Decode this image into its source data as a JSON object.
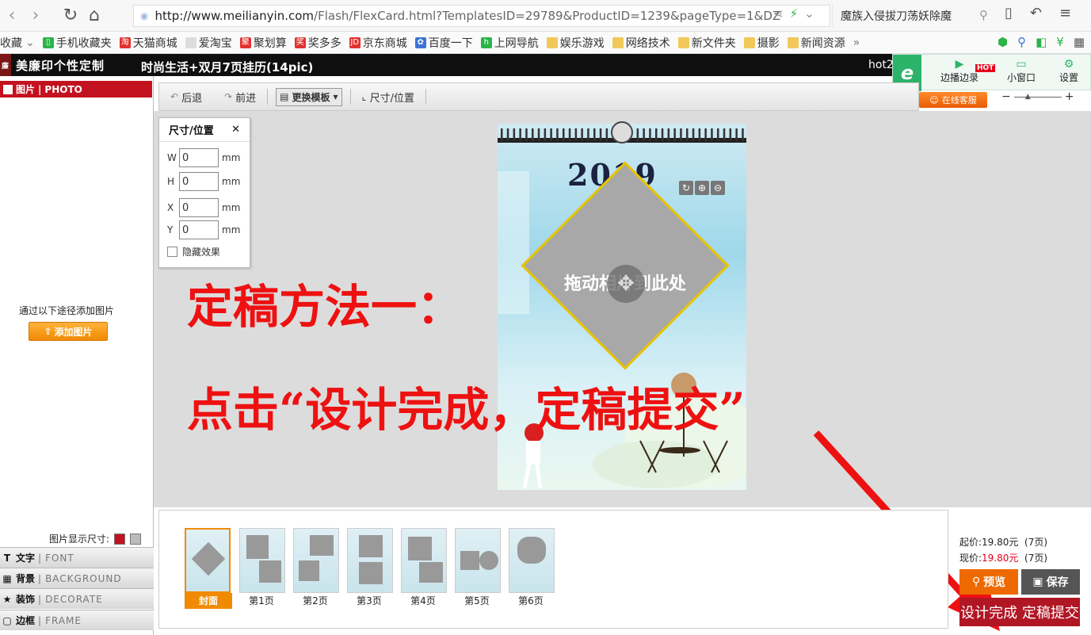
{
  "browser": {
    "url_host": "http://www.meilianyin.com",
    "url_rest": "/Flash/FlexCard.html?TemplatesID=29789&ProductID=1239&pageType=1&DZ",
    "search_text": "魔族入侵拔刀荡妖除魔"
  },
  "bookmarks": [
    {
      "label": "收藏",
      "icon": "star-icon"
    },
    {
      "label": "手机收藏夹",
      "icon": "phone-icon"
    },
    {
      "label": "天猫商城",
      "icon": "tmall-icon"
    },
    {
      "label": "爱淘宝",
      "icon": "page-icon"
    },
    {
      "label": "聚划算",
      "icon": "juhuasuan-icon"
    },
    {
      "label": "奖多多",
      "icon": "prize-icon"
    },
    {
      "label": "京东商城",
      "icon": "jd-icon"
    },
    {
      "label": "百度一下",
      "icon": "baidu-icon"
    },
    {
      "label": "上网导航",
      "icon": "hao-icon"
    },
    {
      "label": "娱乐游戏",
      "icon": "folder-icon"
    },
    {
      "label": "网络技术",
      "icon": "folder-icon"
    },
    {
      "label": "新文件夹",
      "icon": "folder-icon"
    },
    {
      "label": "摄影",
      "icon": "folder-icon"
    },
    {
      "label": "新闻资源",
      "icon": "folder-icon"
    }
  ],
  "app": {
    "logo": "美廉印个性定制",
    "title": "时尚生活+双月7页挂历(14pic)",
    "hot": "hot2"
  },
  "widget": {
    "live": "边播边录",
    "hot_badge": "HOT",
    "mini": "小窗口",
    "settings": "设置",
    "service": "在线客服"
  },
  "left": {
    "photo_tab": "图片",
    "photo_tab_en": "PHOTO",
    "add_hint": "通过以下途径添加图片",
    "add_button": "添加图片",
    "size_label": "图片显示尺寸:",
    "tabs": [
      {
        "cn": "文字",
        "en": "FONT",
        "icon": "T"
      },
      {
        "cn": "背景",
        "en": "BACKGROUND",
        "icon": "▦"
      },
      {
        "cn": "装饰",
        "en": "DECORATE",
        "icon": "★"
      },
      {
        "cn": "边框",
        "en": "FRAME",
        "icon": "▢"
      }
    ]
  },
  "toolbar": {
    "back": "后退",
    "forward": "前进",
    "template": "更换模板",
    "size_pos": "尺寸/位置"
  },
  "size_panel": {
    "title": "尺寸/位置",
    "w_label": "W",
    "w_value": "0",
    "h_label": "H",
    "h_value": "0",
    "x_label": "X",
    "x_value": "0",
    "y_label": "Y",
    "y_value": "0",
    "unit": "mm",
    "hide_effect": "隐藏效果"
  },
  "calendar": {
    "year": "2019",
    "drop_text": "拖动相片到此处"
  },
  "annotation": {
    "line1": "定稿方法一：",
    "line2": "点击“设计完成，定稿提交”"
  },
  "thumbnails": [
    {
      "label": "封面",
      "active": true
    },
    {
      "label": "第1页",
      "active": false
    },
    {
      "label": "第2页",
      "active": false
    },
    {
      "label": "第3页",
      "active": false
    },
    {
      "label": "第4页",
      "active": false
    },
    {
      "label": "第5页",
      "active": false
    },
    {
      "label": "第6页",
      "active": false
    }
  ],
  "price": {
    "start_label": "起价:",
    "start_value": "19.80元",
    "start_pages": "(7页)",
    "now_label": "现价:",
    "now_value": "19.80元",
    "now_pages": "(7页)"
  },
  "actions": {
    "preview": "预览",
    "save": "保存",
    "submit": "设计完成 定稿提交"
  },
  "colors": {
    "brand_red": "#c3121f",
    "accent_orange": "#f08a00",
    "annotation_red": "#ee1111"
  }
}
